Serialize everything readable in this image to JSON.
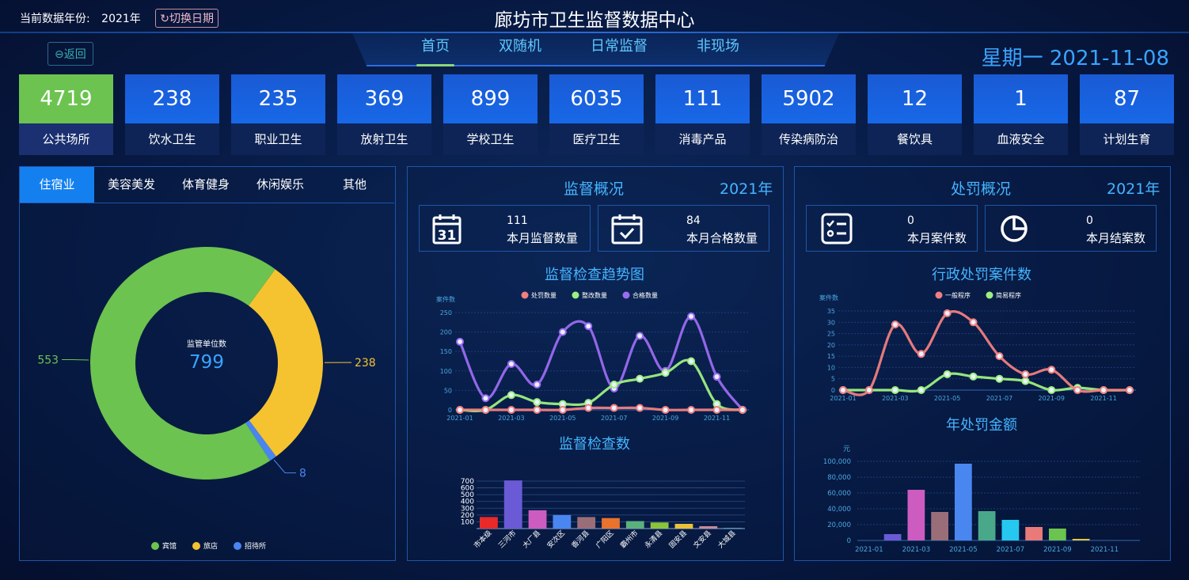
{
  "header": {
    "year_label": "当前数据年份:",
    "year_value": "2021年",
    "switch_label": "切换日期",
    "title": "廊坊市卫生监督数据中心",
    "back_label": "返回",
    "date": "星期一 2021-11-08",
    "nav": [
      "首页",
      "双随机",
      "日常监督",
      "非现场"
    ]
  },
  "cards": [
    {
      "value": "4719",
      "label": "公共场所"
    },
    {
      "value": "238",
      "label": "饮水卫生"
    },
    {
      "value": "235",
      "label": "职业卫生"
    },
    {
      "value": "369",
      "label": "放射卫生"
    },
    {
      "value": "899",
      "label": "学校卫生"
    },
    {
      "value": "6035",
      "label": "医疗卫生"
    },
    {
      "value": "111",
      "label": "消毒产品"
    },
    {
      "value": "5902",
      "label": "传染病防治"
    },
    {
      "value": "12",
      "label": "餐饮具"
    },
    {
      "value": "1",
      "label": "血液安全"
    },
    {
      "value": "87",
      "label": "计划生育"
    }
  ],
  "left_tabs": [
    "住宿业",
    "美容美发",
    "体育健身",
    "休闲娱乐",
    "其他"
  ],
  "supervision": {
    "title": "监督概况",
    "year": "2021年",
    "stat1_value": "111",
    "stat1_label": "本月监督数量",
    "stat1_icon_text": "31",
    "stat2_value": "84",
    "stat2_label": "本月合格数量"
  },
  "penalty": {
    "title": "处罚概况",
    "year": "2021年",
    "stat1_value": "0",
    "stat1_label": "本月案件数",
    "stat2_value": "0",
    "stat2_label": "本月结案数"
  },
  "chart_data": [
    {
      "type": "pie",
      "center_label": "监管单位数",
      "center_value": "799",
      "slices": [
        {
          "name": "宾馆",
          "value": 553,
          "color": "#6cc350"
        },
        {
          "name": "旅店",
          "value": 238,
          "color": "#f5c230"
        },
        {
          "name": "招待所",
          "value": 8,
          "color": "#4a86f0"
        }
      ]
    },
    {
      "type": "line",
      "title": "监督检查趋势图",
      "ylabel": "案件数",
      "ylim": [
        0,
        250
      ],
      "yticks": [
        "0",
        "50",
        "100",
        "150",
        "200",
        "250"
      ],
      "xticks": [
        "2021-01",
        "2021-03",
        "2021-05",
        "2021-07",
        "2021-09",
        "2021-11"
      ],
      "series": [
        {
          "name": "处罚数量",
          "color": "#f07f7f",
          "values": [
            0,
            0,
            0,
            0,
            0,
            5,
            5,
            5,
            0,
            0,
            0,
            0
          ]
        },
        {
          "name": "整改数量",
          "color": "#9df07f",
          "values": [
            0,
            0,
            38,
            20,
            15,
            18,
            65,
            80,
            95,
            125,
            15,
            0
          ]
        },
        {
          "name": "合格数量",
          "color": "#9a6cf0",
          "values": [
            175,
            30,
            118,
            65,
            200,
            215,
            55,
            190,
            100,
            240,
            85,
            0
          ]
        }
      ]
    },
    {
      "type": "bar",
      "title": "监督检查数",
      "ylim": [
        0,
        700
      ],
      "yticks": [
        "100",
        "200",
        "300",
        "400",
        "500",
        "600",
        "700"
      ],
      "categories": [
        "市本级",
        "三河市",
        "大厂县",
        "安次区",
        "香河县",
        "广阳区",
        "霸州市",
        "永清县",
        "固安县",
        "文安县",
        "大城县"
      ],
      "values": [
        170,
        710,
        270,
        200,
        170,
        155,
        110,
        90,
        70,
        35,
        10
      ],
      "colors": [
        "#e82a2a",
        "#6a5ad6",
        "#cc5cc0",
        "#4a86f0",
        "#9a6e78",
        "#e8732e",
        "#5ab07c",
        "#8ac43c",
        "#e8c23a",
        "#c48a9a",
        "#4ab0c8"
      ]
    },
    {
      "type": "line",
      "title": "行政处罚案件数",
      "ylabel": "案件数",
      "ylim": [
        0,
        35
      ],
      "yticks": [
        "0",
        "5",
        "10",
        "15",
        "20",
        "25",
        "30",
        "35"
      ],
      "xticks": [
        "2021-01",
        "2021-03",
        "2021-05",
        "2021-07",
        "2021-09",
        "2021-11"
      ],
      "series": [
        {
          "name": "一般程序",
          "color": "#f07f7f",
          "values": [
            0,
            0,
            29,
            16,
            34,
            30,
            15,
            7,
            9,
            0,
            0,
            0
          ]
        },
        {
          "name": "简易程序",
          "color": "#9df07f",
          "values": [
            0,
            0,
            0,
            0,
            7,
            6,
            5,
            4,
            0,
            1,
            0,
            0
          ]
        }
      ]
    },
    {
      "type": "bar",
      "title": "年处罚金额",
      "ylabel": "元",
      "ylim": [
        0,
        100000
      ],
      "yticks": [
        "0",
        "20,000",
        "40,000",
        "60,000",
        "80,000",
        "100,000"
      ],
      "xticks": [
        "2021-01",
        "2021-03",
        "2021-05",
        "2021-07",
        "2021-09",
        "2021-11"
      ],
      "categories": [
        "2021-01",
        "2021-02",
        "2021-03",
        "2021-04",
        "2021-05",
        "2021-06",
        "2021-07",
        "2021-08",
        "2021-09",
        "2021-10",
        "2021-11",
        "2021-12"
      ],
      "values": [
        0,
        8000,
        64000,
        36000,
        97000,
        37000,
        26000,
        17000,
        15000,
        2000,
        0,
        0
      ],
      "colors": [
        "#e82a2a",
        "#6a5ad6",
        "#cc5cc0",
        "#9a6e78",
        "#4a86f0",
        "#4aa88a",
        "#26c8f0",
        "#e87a7a",
        "#6cc350",
        "#e8c23a",
        "#4ab0c8",
        "#c48a9a"
      ]
    }
  ]
}
